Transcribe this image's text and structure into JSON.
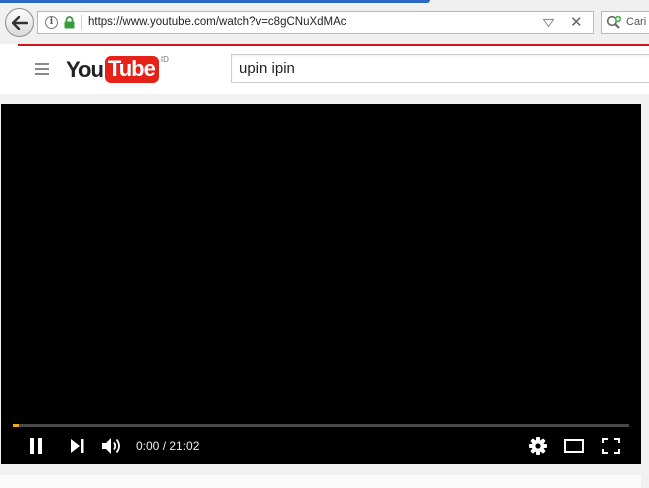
{
  "browser": {
    "url": "https://www.youtube.com/watch?v=c8gCNuXdMAc",
    "search_placeholder": "Cari",
    "icons": [
      "back-arrow-icon",
      "info-icon",
      "lock-icon",
      "dropdown-icon",
      "close-icon",
      "search-icon"
    ]
  },
  "header": {
    "logo_you": "You",
    "logo_tube": "Tube",
    "logo_region": "ID",
    "search_query": "upin ipin",
    "colors": {
      "accent": "#cc181e",
      "logo_red": "#e62117"
    }
  },
  "player": {
    "time_display": "0:00 / 21:02",
    "progress_fraction": 0.01,
    "controls": [
      "pause",
      "next",
      "volume",
      "settings",
      "theater",
      "fullscreen"
    ],
    "progress_color": "#f5a623"
  }
}
